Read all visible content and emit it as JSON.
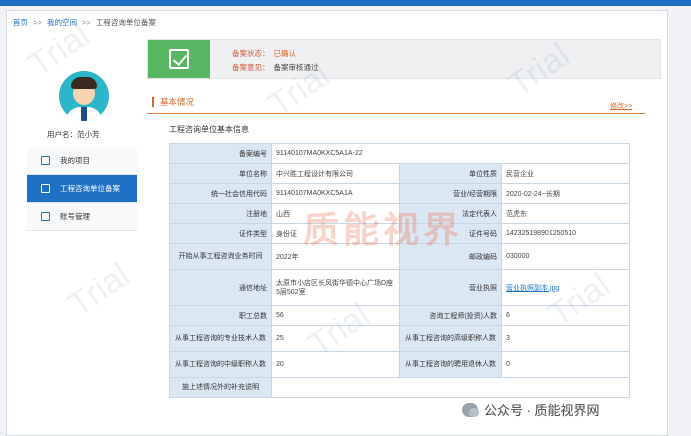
{
  "breadcrumb": {
    "home": "首页",
    "sep1": ">>",
    "myapps": "我的空间",
    "sep2": ">>",
    "current": "工程咨询单位备案"
  },
  "sidebar": {
    "username_label": "用户名：",
    "username": "范小芳",
    "items": [
      {
        "label": "我的项目",
        "icon": "document-icon"
      },
      {
        "label": "工程咨询单位备案",
        "icon": "file-icon",
        "active": true
      },
      {
        "label": "账号管理",
        "icon": "account-icon"
      }
    ]
  },
  "status": {
    "state_label": "备案状态：",
    "state_value": "已确认",
    "opinion_label": "备案意见：",
    "opinion_value": "备案审核通过",
    "accent": "#58b562"
  },
  "section": {
    "title": "基本情况",
    "edit": "修改>>",
    "caption": "工程咨询单位基本信息"
  },
  "table": {
    "record_no_k": "备案编号",
    "record_no_v": "91140107MA0KXC5A1A-22",
    "unit_name_k": "单位名称",
    "unit_name_v": "中兴胜工程设计有限公司",
    "unit_nature_k": "单位性质",
    "unit_nature_v": "民营企业",
    "credit_code_k": "统一社会信用代码",
    "credit_code_v": "91140107MA0KXC5A1A",
    "period_k": "营业/经营期限",
    "period_v": "2020-02-24~长期",
    "reg_place_k": "注册地",
    "reg_place_v": "山西",
    "legal_rep_k": "法定代表人",
    "legal_rep_v": "范虎东",
    "id_type_k": "证件类型",
    "id_type_v": "身份证",
    "id_no_k": "证件号码",
    "id_no_v": "142325198901250510",
    "start_year_k": "开始从事工程咨询业务时间",
    "start_year_v": "2022年",
    "postcode_k": "邮政编码",
    "postcode_v": "030000",
    "address_k": "通信地址",
    "address_v": "太原市小店区长风街华德中心广场D座5层502室",
    "license_k": "营业执照",
    "license_v": "营业执照副本.jpg",
    "staff_k": "职工总数",
    "staff_v": "56",
    "consult_eng_k": "咨询工程师(投资)人数",
    "consult_eng_v": "6",
    "pro_tech_k": "从事工程咨询的专业技术人数",
    "pro_tech_v": "25",
    "senior_k": "从事工程咨询的高级职称人数",
    "senior_v": "3",
    "middle_k": "从事工程咨询的中级职称人数",
    "middle_v": "20",
    "retired_k": "从事工程咨询的聘用退休人数",
    "retired_v": "0",
    "other_k": "施上述情况外的补充说明",
    "other_v": ""
  },
  "watermarks": {
    "center": "质能视界",
    "trial": "Trial",
    "corner": "公众号 · 质能视界网"
  }
}
